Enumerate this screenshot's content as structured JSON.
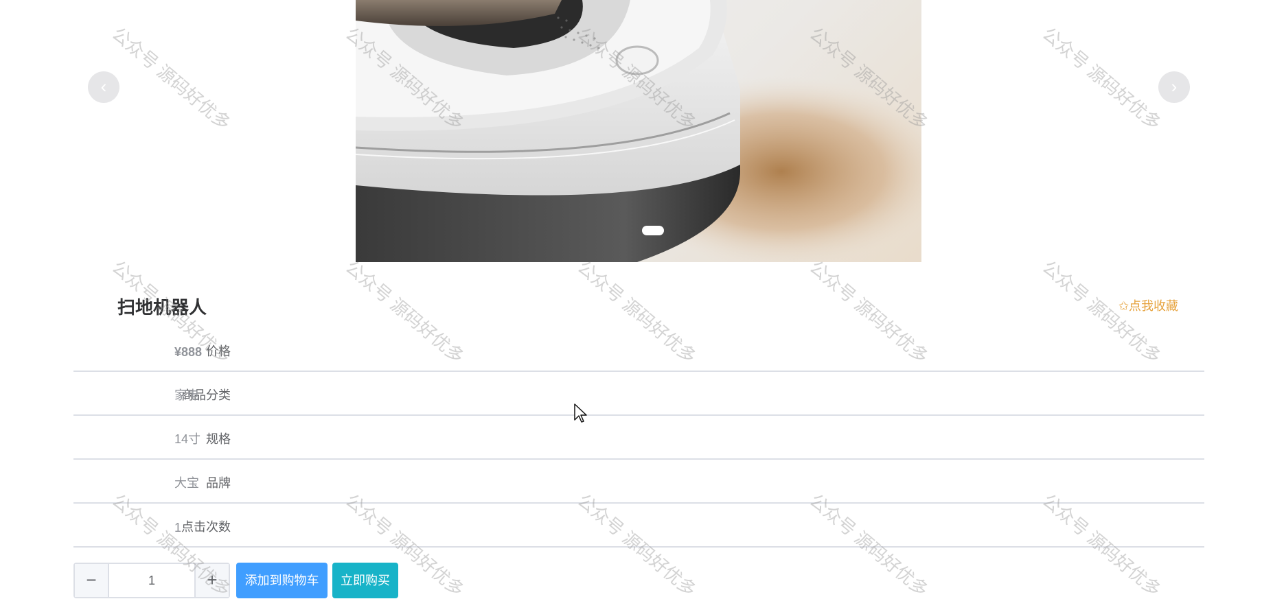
{
  "carousel": {
    "prev_label": "‹",
    "next_label": "›"
  },
  "product": {
    "title": "扫地机器人",
    "favorite_label": "✩点我收藏"
  },
  "details": [
    {
      "label": "价格",
      "value": "¥888"
    },
    {
      "label": "商品分类",
      "value": "家电"
    },
    {
      "label": "规格",
      "value": "14寸"
    },
    {
      "label": "品牌",
      "value": "大宝"
    },
    {
      "label": "点击次数",
      "value": "1"
    }
  ],
  "actions": {
    "minus_label": "−",
    "plus_label": "+",
    "quantity": "1",
    "add_to_cart_label": "添加到购物车",
    "buy_now_label": "立即购买"
  },
  "watermark": {
    "text": "公众号 源码好优多"
  },
  "colors": {
    "primary": "#409eff",
    "buy": "#17b3c8",
    "favorite": "#e6a23c"
  }
}
